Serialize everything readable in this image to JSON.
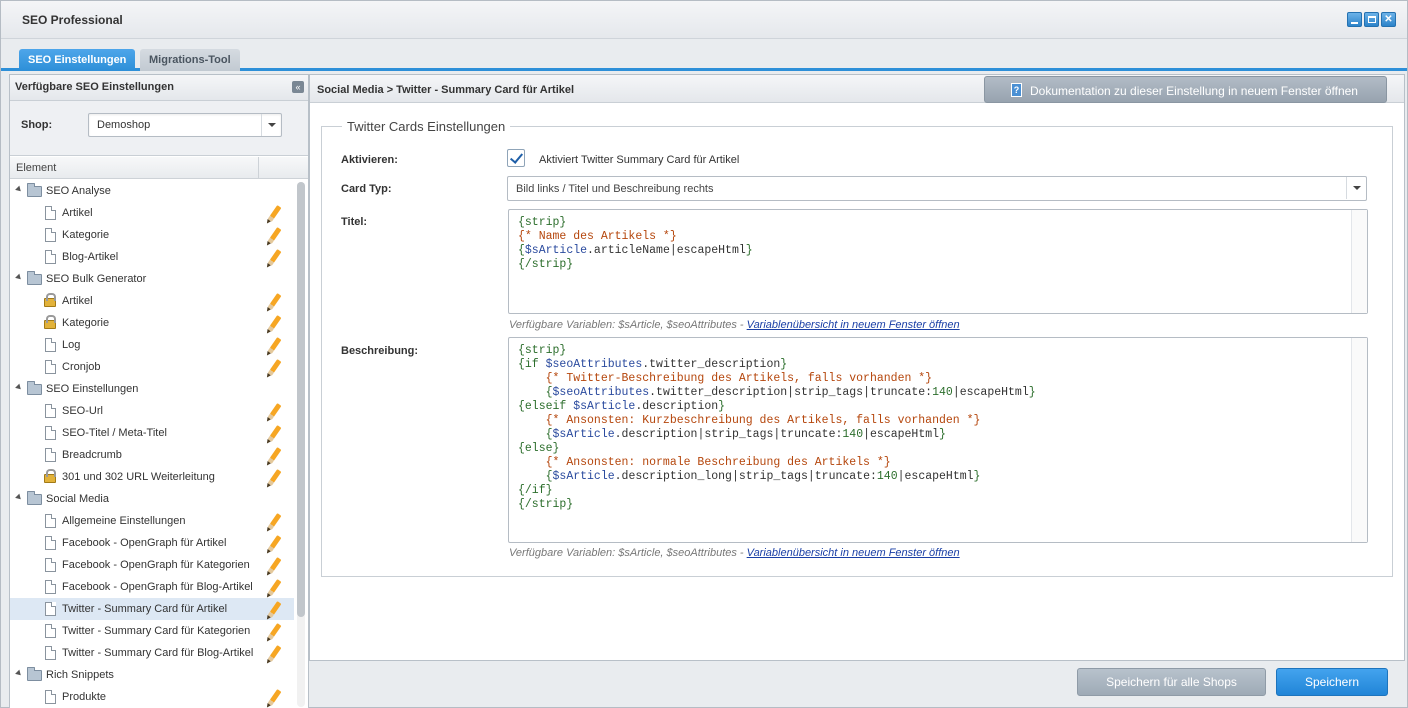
{
  "window": {
    "title": "SEO Professional"
  },
  "tabs": [
    {
      "label": "SEO Einstellungen",
      "active": true
    },
    {
      "label": "Migrations-Tool",
      "active": false
    }
  ],
  "left_panel": {
    "title": "Verfügbare SEO Einstellungen",
    "shop_label": "Shop:",
    "shop_value": "Demoshop",
    "tree_column": "Element",
    "tree": [
      {
        "type": "folder",
        "label": "SEO Analyse"
      },
      {
        "type": "item",
        "label": "Artikel",
        "icon": "document-icon"
      },
      {
        "type": "item",
        "label": "Kategorie",
        "icon": "document-icon"
      },
      {
        "type": "item",
        "label": "Blog-Artikel",
        "icon": "document-icon"
      },
      {
        "type": "folder",
        "label": "SEO Bulk Generator"
      },
      {
        "type": "item",
        "label": "Artikel",
        "icon": "lock-icon"
      },
      {
        "type": "item",
        "label": "Kategorie",
        "icon": "lock-icon"
      },
      {
        "type": "item",
        "label": "Log",
        "icon": "document-icon"
      },
      {
        "type": "item",
        "label": "Cronjob",
        "icon": "document-icon"
      },
      {
        "type": "folder",
        "label": "SEO Einstellungen"
      },
      {
        "type": "item",
        "label": "SEO-Url",
        "icon": "document-icon"
      },
      {
        "type": "item",
        "label": "SEO-Titel / Meta-Titel",
        "icon": "document-icon"
      },
      {
        "type": "item",
        "label": "Breadcrumb",
        "icon": "document-icon"
      },
      {
        "type": "item",
        "label": "301 und 302 URL Weiterleitung",
        "icon": "lock-icon"
      },
      {
        "type": "folder",
        "label": "Social Media"
      },
      {
        "type": "item",
        "label": "Allgemeine Einstellungen",
        "icon": "document-icon"
      },
      {
        "type": "item",
        "label": "Facebook - OpenGraph für Artikel",
        "icon": "document-icon"
      },
      {
        "type": "item",
        "label": "Facebook - OpenGraph für Kategorien",
        "icon": "document-icon"
      },
      {
        "type": "item",
        "label": "Facebook - OpenGraph für Blog-Artikel",
        "icon": "document-icon"
      },
      {
        "type": "item",
        "label": "Twitter - Summary Card für Artikel",
        "icon": "document-icon",
        "selected": true
      },
      {
        "type": "item",
        "label": "Twitter - Summary Card für Kategorien",
        "icon": "document-icon"
      },
      {
        "type": "item",
        "label": "Twitter - Summary Card für Blog-Artikel",
        "icon": "document-icon"
      },
      {
        "type": "folder",
        "label": "Rich Snippets"
      },
      {
        "type": "item",
        "label": "Produkte",
        "icon": "document-icon"
      }
    ]
  },
  "right_panel": {
    "breadcrumb": "Social Media > Twitter - Summary Card für Artikel",
    "doc_button": "Dokumentation zu dieser Einstellung in neuem Fenster öffnen",
    "fieldset_title": "Twitter Cards Einstellungen",
    "activate_label": "Aktivieren:",
    "activate_text": "Aktiviert Twitter Summary Card für Artikel",
    "activate_checked": true,
    "cardtype_label": "Card Typ:",
    "cardtype_value": "Bild links / Titel und Beschreibung rechts",
    "title_label": "Titel:",
    "title_code": [
      [
        [
          "b",
          "{strip}"
        ]
      ],
      [
        [
          "c",
          "{* Name des Artikels *}"
        ]
      ],
      [
        [
          "b",
          "{"
        ],
        [
          "v",
          "$sArticle"
        ],
        [
          "n",
          ".articleName|escapeHtml"
        ],
        [
          "b",
          "}"
        ]
      ],
      [
        [
          "b",
          "{/strip}"
        ]
      ]
    ],
    "hint_prefix": "Verfügbare Variablen: $sArticle, $seoAttributes - ",
    "hint_link": "Variablenübersicht in neuem Fenster öffnen",
    "desc_label": "Beschreibung:",
    "desc_code": [
      [
        [
          "b",
          "{strip}"
        ]
      ],
      [
        [
          "b",
          "{if "
        ],
        [
          "v",
          "$seoAttributes"
        ],
        [
          "n",
          ".twitter_description"
        ],
        [
          "b",
          "}"
        ]
      ],
      [
        [
          "n",
          "    "
        ],
        [
          "c",
          "{* Twitter-Beschreibung des Artikels, falls vorhanden *}"
        ]
      ],
      [
        [
          "n",
          "    "
        ],
        [
          "b",
          "{"
        ],
        [
          "v",
          "$seoAttributes"
        ],
        [
          "n",
          ".twitter_description|strip_tags|truncate:"
        ],
        [
          "b",
          "140"
        ],
        [
          "n",
          "|escapeHtml"
        ],
        [
          "b",
          "}"
        ]
      ],
      [
        [
          "b",
          "{elseif "
        ],
        [
          "v",
          "$sArticle"
        ],
        [
          "n",
          ".description"
        ],
        [
          "b",
          "}"
        ]
      ],
      [
        [
          "n",
          "    "
        ],
        [
          "c",
          "{* Ansonsten: Kurzbeschreibung des Artikels, falls vorhanden *}"
        ]
      ],
      [
        [
          "n",
          "    "
        ],
        [
          "b",
          "{"
        ],
        [
          "v",
          "$sArticle"
        ],
        [
          "n",
          ".description|strip_tags|truncate:"
        ],
        [
          "b",
          "140"
        ],
        [
          "n",
          "|escapeHtml"
        ],
        [
          "b",
          "}"
        ]
      ],
      [
        [
          "b",
          "{else}"
        ]
      ],
      [
        [
          "n",
          "    "
        ],
        [
          "c",
          "{* Ansonsten: normale Beschreibung des Artikels *}"
        ]
      ],
      [
        [
          "n",
          "    "
        ],
        [
          "b",
          "{"
        ],
        [
          "v",
          "$sArticle"
        ],
        [
          "n",
          ".description_long|strip_tags|truncate:"
        ],
        [
          "b",
          "140"
        ],
        [
          "n",
          "|escapeHtml"
        ],
        [
          "b",
          "}"
        ]
      ],
      [
        [
          "b",
          "{/if}"
        ]
      ],
      [
        [
          "b",
          "{/strip}"
        ]
      ]
    ]
  },
  "footer": {
    "save_all_label": "Speichern für alle Shops",
    "save_label": "Speichern"
  },
  "colors": {
    "accent": "#2d8fd8",
    "code_block": "#2c6e2c",
    "code_comment": "#b5460c",
    "code_variable": "#2a4a9e"
  }
}
